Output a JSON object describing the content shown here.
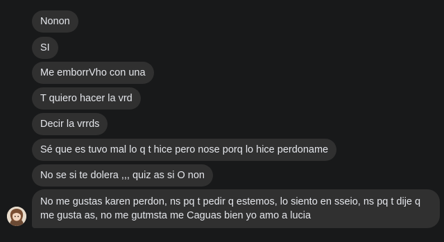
{
  "messages": [
    {
      "text": "Nonon"
    },
    {
      "text": "SI"
    },
    {
      "text": "Me emborrVho con una"
    },
    {
      "text": "T quiero hacer la vrd"
    },
    {
      "text": "Decir la vrrds"
    },
    {
      "text": "Sé que es tuvo mal lo q t hice pero nose porq lo hice perdoname"
    },
    {
      "text": "No se si te dolera   ,,, quiz as si O non"
    },
    {
      "text": "No me gustas karen perdon, ns pq t pedir q estemos, lo siento en sseio, ns pq t dije q me gusta as, no me gutmsta  me Caguas bien yo amo a lucia"
    }
  ],
  "colors": {
    "background": "#18191a",
    "bubble": "#303030",
    "text": "#e4e6eb"
  },
  "avatar": {
    "icon": "avatar-icon"
  }
}
